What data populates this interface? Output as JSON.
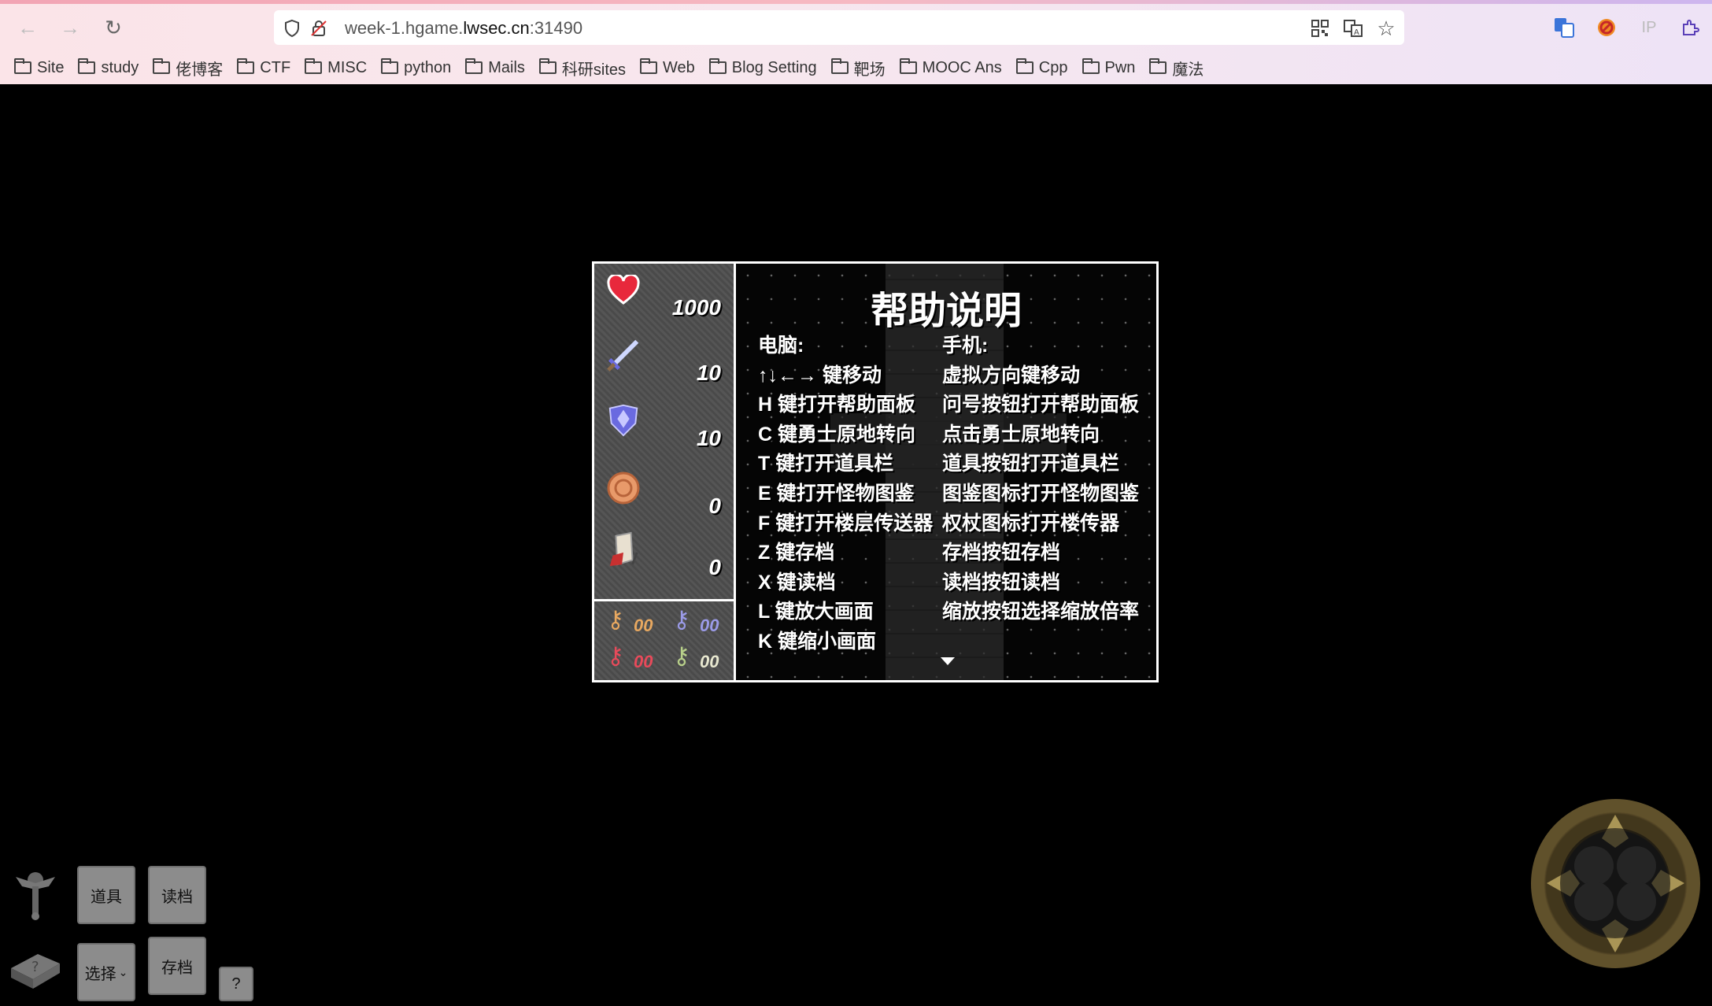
{
  "browser": {
    "url_host_prefix": "week-1.hgame.",
    "url_host_domain": "lwsec.cn",
    "url_port": ":31490",
    "ext_ip_label": "IP"
  },
  "bookmarks": [
    "Site",
    "study",
    "佬博客",
    "CTF",
    "MISC",
    "python",
    "Mails",
    "科研sites",
    "Web",
    "Blog Setting",
    "靶场",
    "MOOC Ans",
    "Cpp",
    "Pwn",
    "魔法"
  ],
  "status": {
    "hp": "1000",
    "attack": "10",
    "defense": "10",
    "gold": "0",
    "experience": "0"
  },
  "keys": {
    "yellow": "00",
    "blue": "00",
    "red": "00",
    "green": "00"
  },
  "help": {
    "title": "帮助说明",
    "pc_header": "电脑:",
    "mobile_header": "手机:",
    "pc_lines": [
      "↑↓←→ 键移动",
      "H 键打开帮助面板",
      "C 键勇士原地转向",
      "T 键打开道具栏",
      "E 键打开怪物图鉴",
      "F 键打开楼层传送器",
      "Z 键存档",
      "X 键读档",
      "L 键放大画面",
      "K 键缩小画面"
    ],
    "mobile_lines": [
      "虚拟方向键移动",
      "问号按钮打开帮助面板",
      "点击勇士原地转向",
      "道具按钮打开道具栏",
      "图鉴图标打开怪物图鉴",
      "权杖图标打开楼传器",
      "存档按钮存档",
      "读档按钮读档",
      "缩放按钮选择缩放倍率"
    ]
  },
  "controls": {
    "items_label": "道具",
    "load_label": "读档",
    "select_label": "选择",
    "save_label": "存档",
    "help_label": "?"
  },
  "colors": {
    "key_yellow": "#e8a860",
    "key_blue": "#9b9be8",
    "key_red": "#e84a5a",
    "key_green": "#b8d08a"
  }
}
